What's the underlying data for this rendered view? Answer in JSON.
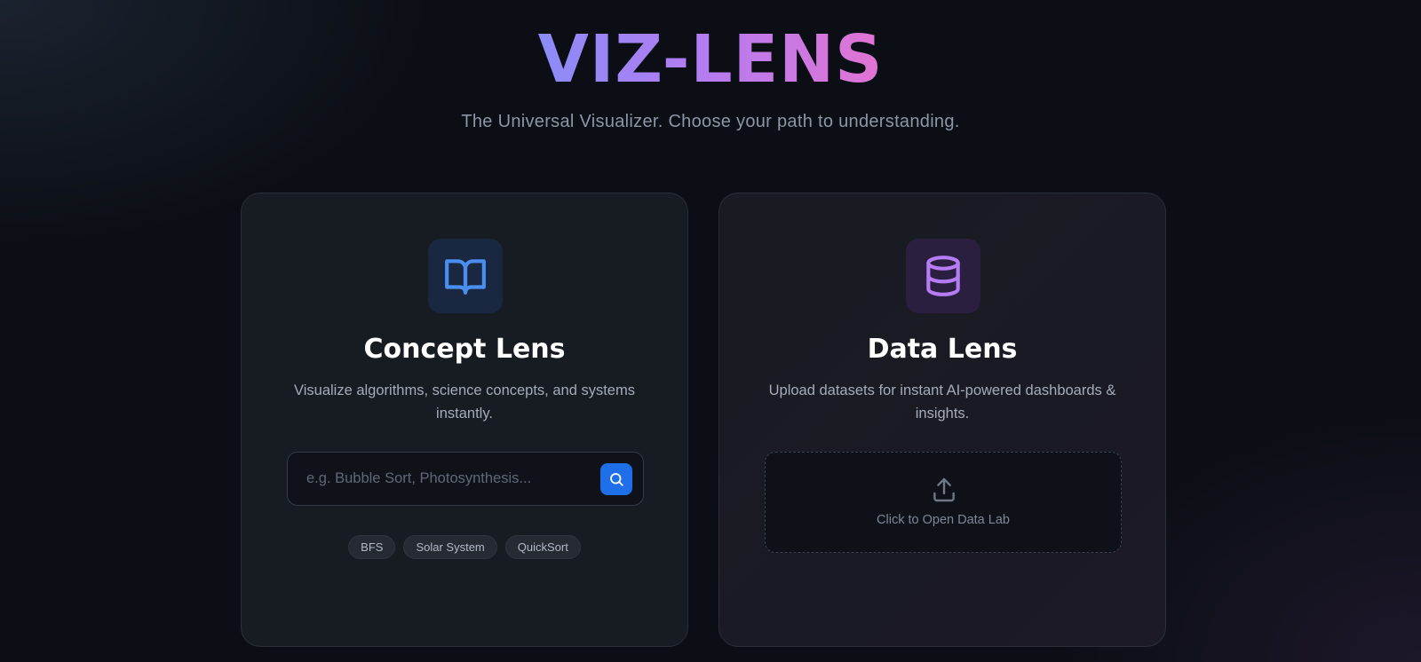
{
  "hero": {
    "title": "VIZ-LENS",
    "subtitle": "The Universal Visualizer. Choose your path to understanding."
  },
  "concept_lens": {
    "icon": "book-open-icon",
    "title": "Concept Lens",
    "description": "Visualize algorithms, science concepts, and systems instantly.",
    "search": {
      "placeholder": "e.g. Bubble Sort, Photosynthesis...",
      "value": ""
    },
    "chips": [
      "BFS",
      "Solar System",
      "QuickSort"
    ]
  },
  "data_lens": {
    "icon": "database-icon",
    "title": "Data Lens",
    "description": "Upload datasets for instant AI-powered dashboards & insights.",
    "upload_label": "Click to Open Data Lab"
  },
  "colors": {
    "accent_blue": "#1f6feb",
    "title_gradient": [
      "#8b8cf8",
      "#b27cf2",
      "#e274d3"
    ],
    "book_icon": "#4a8ff0",
    "database_icon": "#b67cf5"
  }
}
